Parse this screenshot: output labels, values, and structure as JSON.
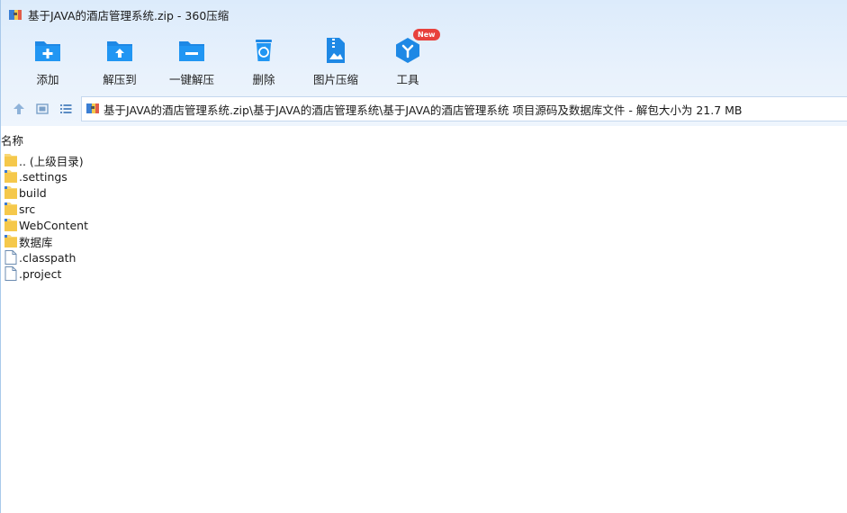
{
  "window": {
    "title": "基于JAVA的酒店管理系统.zip - 360压缩"
  },
  "toolbar": {
    "items": [
      {
        "label": "添加",
        "icon": "add-folder-icon"
      },
      {
        "label": "解压到",
        "icon": "extract-to-icon"
      },
      {
        "label": "一键解压",
        "icon": "one-click-extract-icon"
      },
      {
        "label": "删除",
        "icon": "delete-trash-icon"
      },
      {
        "label": "图片压缩",
        "icon": "image-compress-icon"
      },
      {
        "label": "工具",
        "icon": "tools-icon",
        "badge": "New"
      }
    ]
  },
  "nav": {
    "path": "基于JAVA的酒店管理系统.zip\\基于JAVA的酒店管理系统\\基于JAVA的酒店管理系统 项目源码及数据库文件 - 解包大小为 21.7 MB"
  },
  "columns": {
    "name": "名称"
  },
  "files": [
    {
      "name": ".. (上级目录)",
      "type": "folder"
    },
    {
      "name": ".settings",
      "type": "folder-special"
    },
    {
      "name": "build",
      "type": "folder-special"
    },
    {
      "name": "src",
      "type": "folder-special"
    },
    {
      "name": "WebContent",
      "type": "folder-special"
    },
    {
      "name": "数据库",
      "type": "folder-special"
    },
    {
      "name": ".classpath",
      "type": "file"
    },
    {
      "name": ".project",
      "type": "file"
    }
  ],
  "colors": {
    "accent": "#1e88e5",
    "folder": "#f8d775",
    "badge": "#e8413c"
  }
}
